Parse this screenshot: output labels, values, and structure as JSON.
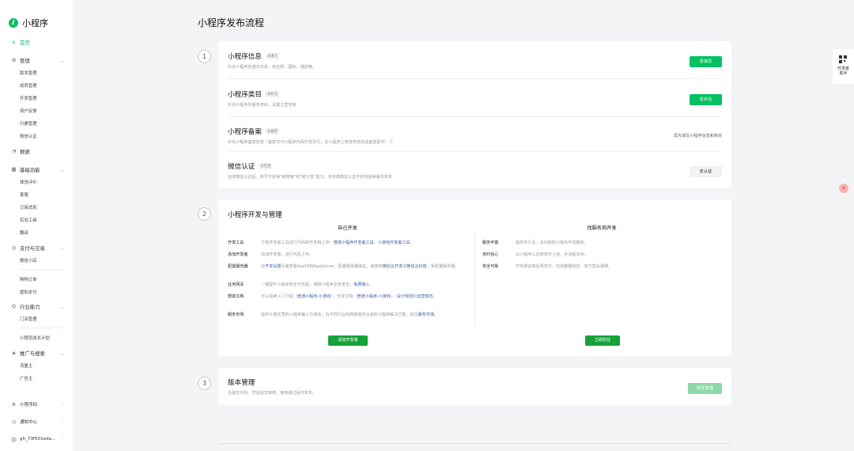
{
  "app": {
    "name": "小程序",
    "logo_icon": "mini-program-logo-icon"
  },
  "sidebar": {
    "home": "首页",
    "groups": [
      {
        "label": "管理",
        "icon": "gear-icon",
        "items": [
          "版本管理",
          "成员管理",
          "开发管理",
          "用户反馈",
          "行妻管理",
          "微信认证"
        ]
      },
      {
        "label": "数据",
        "icon": "chart-icon",
        "items": []
      },
      {
        "label": "基础功能",
        "icon": "grid-icon",
        "items": [
          "体验评价",
          "客服",
          "订阅消息",
          "实验工具",
          "翻译"
        ]
      },
      {
        "label": "支付与交易",
        "icon": "payment-icon",
        "items": [
          "微信小店",
          "购物订单",
          "虚拟支付"
        ]
      },
      {
        "label": "行业能力",
        "icon": "industry-icon",
        "items": [
          "门店管理",
          "小程序成长计划"
        ]
      },
      {
        "label": "推广与搜索",
        "icon": "promote-icon",
        "items": [
          "流量主",
          "广告主"
        ]
      }
    ],
    "bottom": [
      {
        "label": "小程序码",
        "icon": "qrcode-icon"
      },
      {
        "label": "通知中心",
        "icon": "bell-icon"
      },
      {
        "label": "gh_73f501eda...",
        "icon": "avatar"
      }
    ]
  },
  "page": {
    "title": "小程序发布流程"
  },
  "step1": {
    "num": "1",
    "rows": [
      {
        "title": "小程序信息",
        "tag": "未填写",
        "desc": "补充小程序的基本信息，如名称、图标、描述等。",
        "action": "去填写"
      },
      {
        "title": "小程序类目",
        "tag": "未补充",
        "desc": "补充小程序的服务类目，设置主营类目",
        "action": "去补充"
      },
      {
        "title": "小程序备案",
        "tag": "未备案",
        "desc": "补充小程序备案信息（备案可与小程序代码开发并行，在小程序上架发布前完成备案即可）⓵",
        "note": "需先填写小程序信息和类目"
      },
      {
        "title": "微信认证",
        "tag": "未完善",
        "desc": "完成微信认证后，账号可获得\"被搜索\"和\"被分享\"能力。未完成微信认证不影响后续版本发布",
        "action": "去认证"
      }
    ]
  },
  "step2": {
    "num": "2",
    "title": "小程序开发与管理",
    "left_title": "自己开发",
    "right_title": "找服务商开发",
    "left_items": [
      {
        "k": "开发工具",
        "v1": "下载开发者工具进行代码的开发和上传：",
        "l1": "普通小程序开发者工具",
        "v2": "、",
        "l2": "小游戏开发者工具",
        "v3": "。"
      },
      {
        "k": "添加开发者",
        "v1": "添加开发者，进行代码上传。"
      },
      {
        "k": "配置服务器",
        "v1": "在",
        "l1": "开发设置",
        "v2": "页面查看AppID和AppSecret，配置服务器域名。或使用",
        "l2": "微信云开发",
        "v3": "或",
        "l3": "微信云托管",
        "v4": "，免配置服务器。"
      },
      {
        "k": "业务网关",
        "v1": "一键提升小程序安全与性能，保障小程序业务安全。",
        "l1": "免费接入"
      },
      {
        "k": "帮助文档",
        "v1": "可以阅读入门介绍（",
        "l1": "普通小程序",
        "v2": "|",
        "l2": "小游戏",
        "v3": "）、开发文档（",
        "l3": "普通小程序",
        "v4": "|",
        "l4": "小游戏",
        "v5": "）、",
        "l5": "设计规范",
        "v6": "和",
        "l6": "运营规范",
        "v7": "。"
      },
      {
        "k": "服务市场",
        "v1": "提供大量优质的小程序第三方服务，为不同行业的商家提供合适的小程序解决方案。前往",
        "l1": "服务市场",
        "v2": "。"
      }
    ],
    "right_items": [
      {
        "k": "服务丰富",
        "v": "提供多行业、多功能的小程序开发服务。"
      },
      {
        "k": "省时省心",
        "v": "从小程序认证到发布上线，全流程支持。"
      },
      {
        "k": "安全可靠",
        "v": "可免费试用后再支付，在线客服响应，官方售后保障。"
      }
    ],
    "left_button": "添加开发者",
    "right_button": "立即前往"
  },
  "step3": {
    "num": "3",
    "title": "版本管理",
    "desc": "先提交代码，然后提交审核，审核通过后可发布。",
    "action": "前往管理"
  },
  "float_panel": {
    "label_line1": "开发者",
    "label_line2": "助手",
    "icon": "qrcode-icon"
  },
  "badge": {
    "text": "A"
  },
  "colors": {
    "brand": "#07c160",
    "link": "#3a5ba7",
    "background": "#f3f4f6"
  }
}
